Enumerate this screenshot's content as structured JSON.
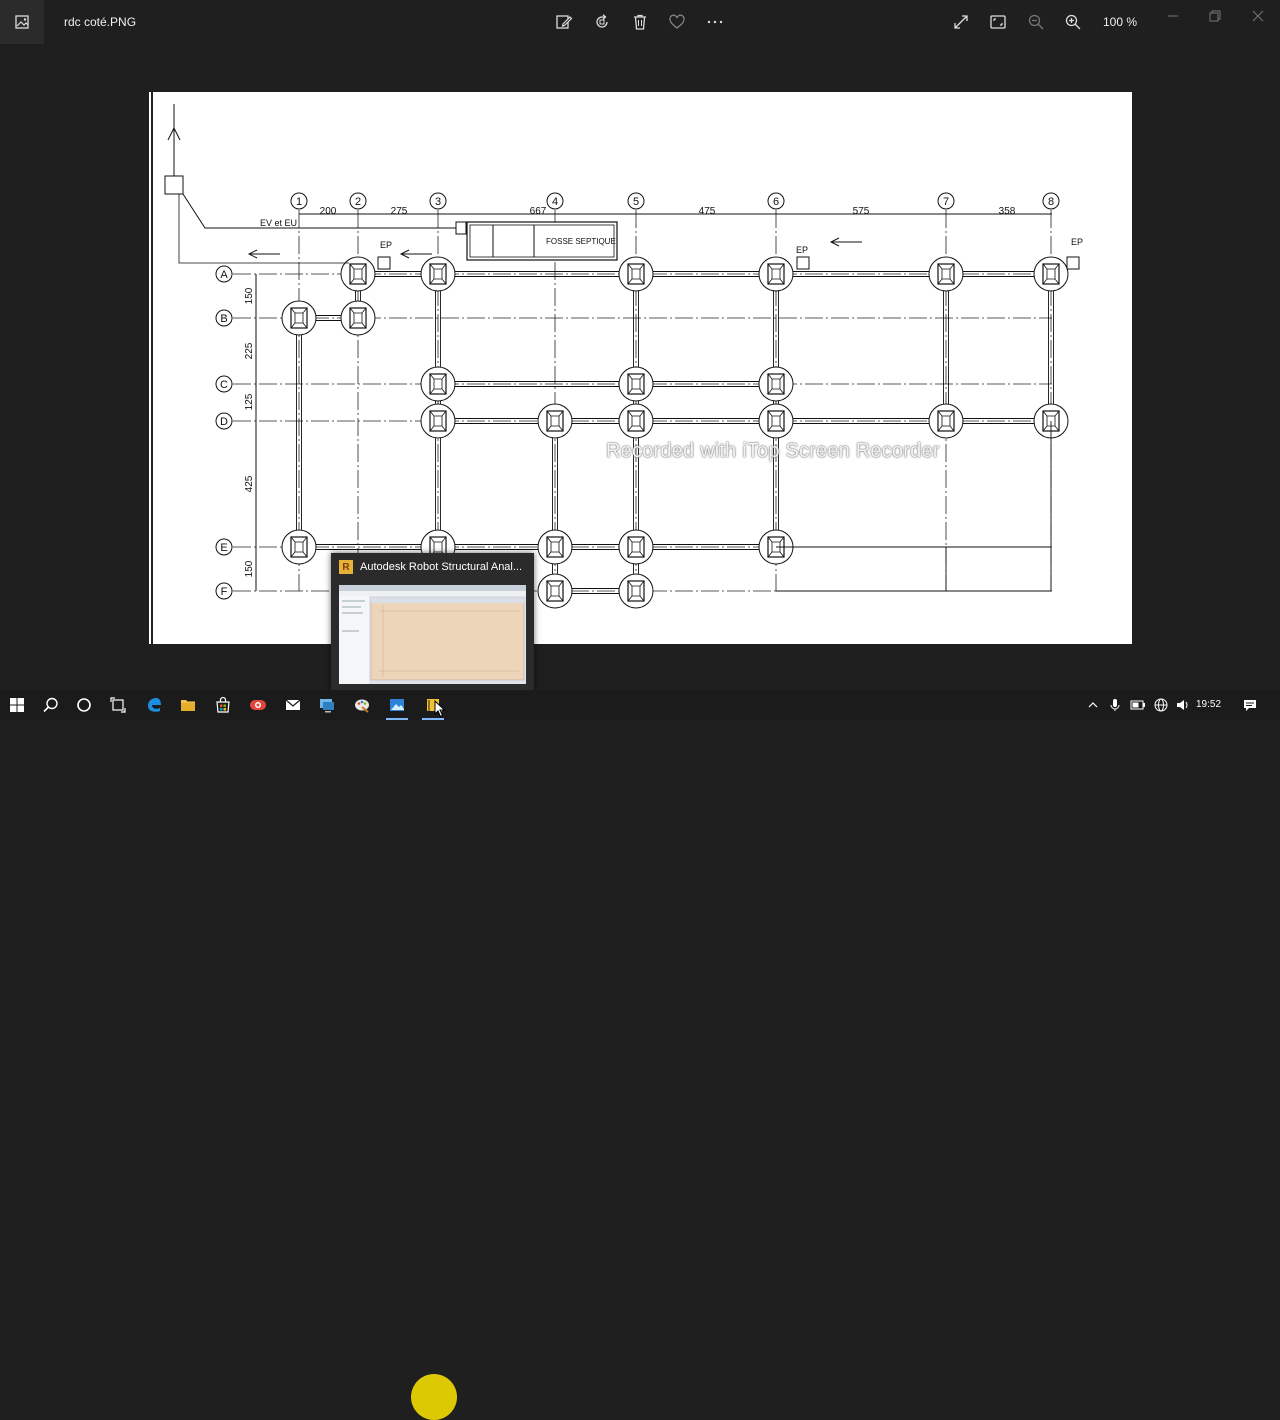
{
  "window": {
    "file_name": "rdc coté.PNG",
    "zoom": "100 %"
  },
  "toolbar": {
    "icons": [
      "edit-icon",
      "rotate-icon",
      "delete-icon",
      "favorite-icon",
      "more-icon"
    ],
    "right_icons": [
      "fullscreen-icon",
      "fit-icon",
      "zoom-out-icon",
      "zoom-in-icon"
    ]
  },
  "drawing": {
    "columns": [
      "1",
      "2",
      "3",
      "4",
      "5",
      "6",
      "7",
      "8"
    ],
    "spacings": [
      "200",
      "275",
      "667",
      "475",
      "575",
      "358"
    ],
    "rows": [
      "A",
      "B",
      "C",
      "D",
      "E",
      "F"
    ],
    "row_spacings": [
      "150",
      "225",
      "125",
      "425",
      "150"
    ],
    "labels": {
      "ev_eu": "EV et EU",
      "ep1": "EP",
      "ep2": "EP",
      "ep3": "EP",
      "fosse": "FOSSE SEPTIQUE"
    }
  },
  "watermark": "Recorded with iTop Screen Recorder",
  "thumbnail": {
    "title": "Autodesk Robot Structural Anal...",
    "app_letter": "R"
  },
  "taskbar": {
    "clock": "19:52",
    "apps": [
      "start-icon",
      "search-icon",
      "cortana-icon",
      "task-view-icon",
      "edge-icon",
      "file-explorer-icon",
      "store-icon",
      "recorder-icon",
      "mail-icon",
      "network-app-icon",
      "paint-icon",
      "photos-icon",
      "robot-icon"
    ]
  },
  "colors": {
    "accent": "#7fb8ff",
    "cursor_highlight": "#ffe600"
  }
}
